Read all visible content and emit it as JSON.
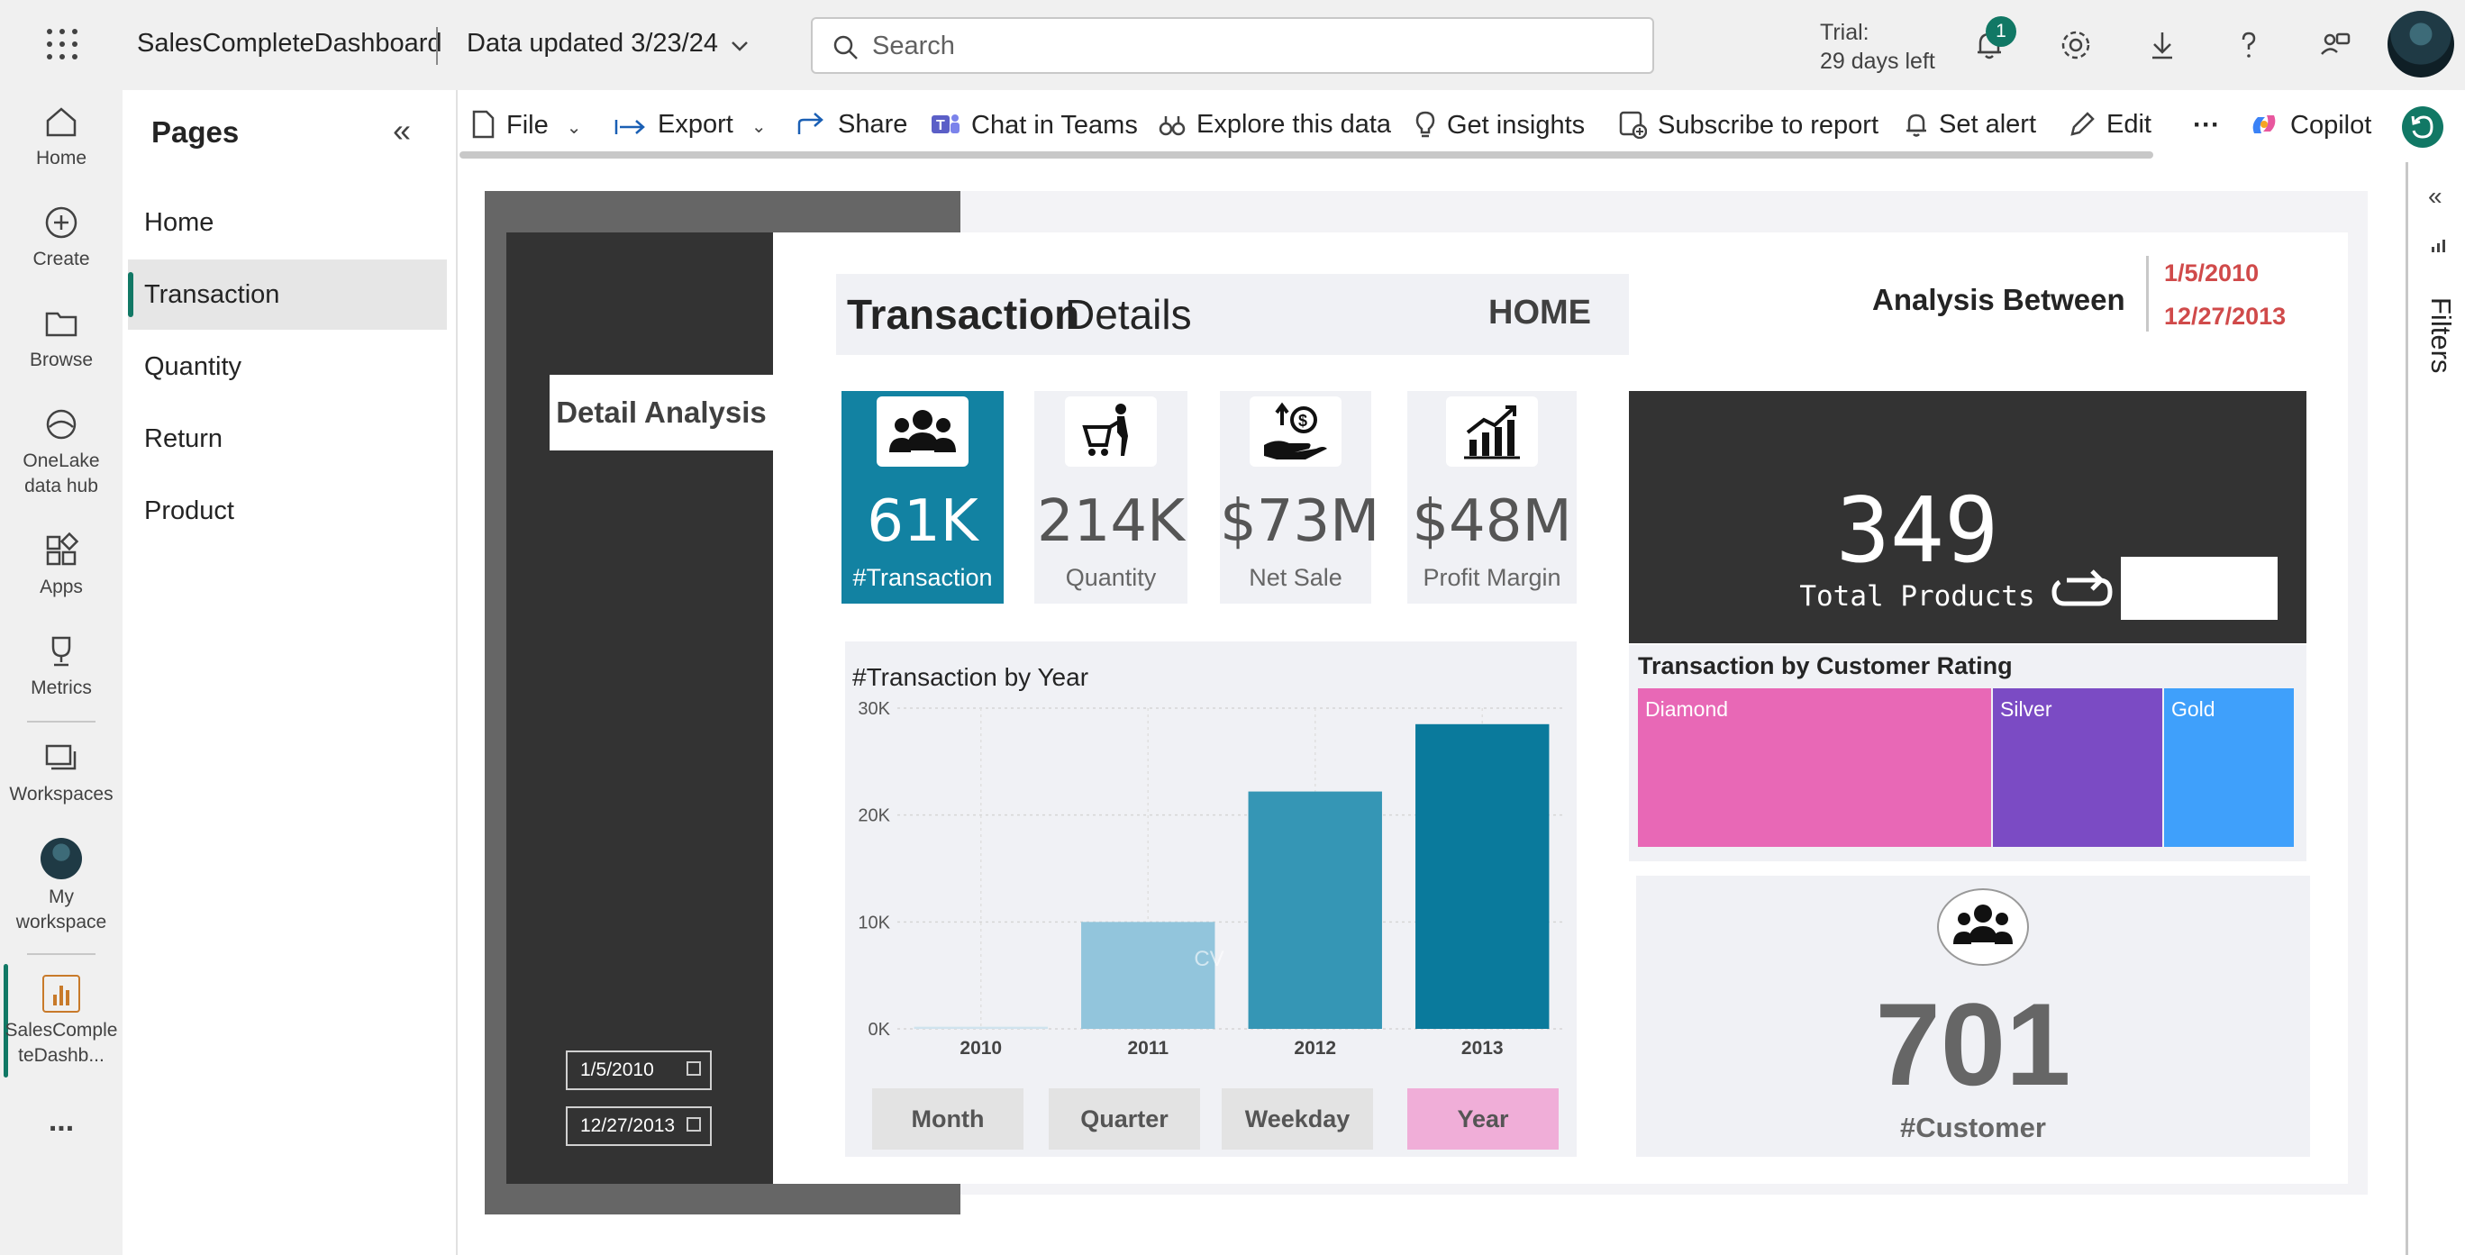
{
  "topbar": {
    "app_title": "SalesCompleteDashboard",
    "data_updated": "Data updated 3/23/24",
    "search_placeholder": "Search",
    "trial_label": "Trial:",
    "trial_days": "29 days left",
    "notification_count": "1"
  },
  "rail": {
    "items": [
      {
        "label": "Home",
        "icon": "home-icon"
      },
      {
        "label": "Create",
        "icon": "plus-circle-icon"
      },
      {
        "label": "Browse",
        "icon": "folder-icon"
      },
      {
        "label": "OneLake\ndata hub",
        "line1": "OneLake",
        "line2": "data hub",
        "icon": "onelake-icon"
      },
      {
        "label": "Apps",
        "icon": "apps-icon"
      },
      {
        "label": "Metrics",
        "icon": "trophy-icon"
      },
      {
        "label": "Workspaces",
        "icon": "workspaces-icon"
      },
      {
        "label": "My workspace",
        "line1": "My",
        "line2": "workspace",
        "icon": "avatar-icon"
      },
      {
        "label": "SalesCompleteDashb...",
        "line1": "SalesComple",
        "line2": "teDashb...",
        "icon": "report-icon"
      }
    ],
    "more": "..."
  },
  "pages": {
    "title": "Pages",
    "items": [
      "Home",
      "Transaction",
      "Quantity",
      "Return",
      "Product"
    ],
    "active": "Transaction"
  },
  "actionbar": {
    "file": "File",
    "export": "Export",
    "share": "Share",
    "chat_in_teams": "Chat in Teams",
    "explore": "Explore this data",
    "insights": "Get insights",
    "subscribe": "Subscribe to report",
    "alert": "Set alert",
    "edit": "Edit",
    "more": "···",
    "copilot": "Copilot"
  },
  "filters": {
    "label": "Filters"
  },
  "report": {
    "detail_tab": "Detail Analysis",
    "slicer_start": "1/5/2010",
    "slicer_end": "12/27/2013",
    "title_bold": "Transaction",
    "title_light": "Details",
    "home_button": "HOME",
    "analysis_label": "Analysis Between",
    "analysis_start": "1/5/2010",
    "analysis_end": "12/27/2013",
    "kpis": [
      {
        "value": "61K",
        "label": "#Transaction",
        "icon": "people-icon",
        "active": true
      },
      {
        "value": "214K",
        "label": "Quantity",
        "icon": "cart-person-icon",
        "active": false
      },
      {
        "value": "$73M",
        "label": "Net Sale",
        "icon": "money-hand-icon",
        "active": false
      },
      {
        "value": "$48M",
        "label": "Profit Margin",
        "icon": "growth-chart-icon",
        "active": false
      }
    ],
    "total_products_value": "349",
    "total_products_label": "Total Products",
    "rating_title": "Transaction by Customer Rating",
    "ratings": [
      {
        "label": "Diamond",
        "color": "#e868b6",
        "share": 0.54
      },
      {
        "label": "Silver",
        "color": "#7b4bc4",
        "share": 0.26
      },
      {
        "label": "Gold",
        "color": "#3fa0fb",
        "share": 0.2
      }
    ],
    "customer_value": "701",
    "customer_label": "#Customer",
    "segments": [
      "Month",
      "Quarter",
      "Weekday",
      "Year"
    ],
    "active_segment": "Year",
    "watermark": "CV"
  },
  "chart_data": {
    "type": "bar",
    "title": "#Transaction by Year",
    "categories": [
      "2010",
      "2011",
      "2012",
      "2013"
    ],
    "values": [
      200,
      10000,
      22200,
      28500
    ],
    "ylim": [
      0,
      30000
    ],
    "yticks": [
      "0K",
      "10K",
      "20K",
      "30K"
    ],
    "ytick_values": [
      0,
      10000,
      20000,
      30000
    ],
    "colors": [
      "#cfe3ee",
      "#92c5dc",
      "#3596b5",
      "#0a7a9c"
    ],
    "xlabel": "",
    "ylabel": "",
    "grid": true
  }
}
